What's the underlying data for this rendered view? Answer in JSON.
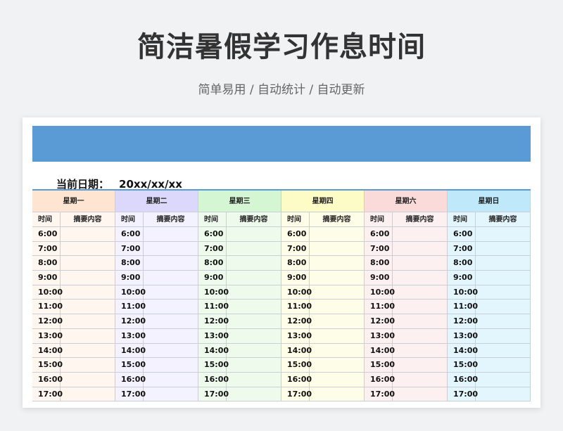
{
  "header": {
    "title": "简洁暑假学习作息时间",
    "subtitle": "简单易用 / 自动统计 / 自动更新"
  },
  "sheet": {
    "date_label": "当前日期：",
    "date_value": "20xx/xx/xx",
    "time_header": "时间",
    "note_header": "摘要内容",
    "days": [
      {
        "label": "星期一",
        "head_color": "#fde5d2",
        "body_color": "#fef6ef"
      },
      {
        "label": "星期二",
        "head_color": "#dcd8fb",
        "body_color": "#f3f2fe"
      },
      {
        "label": "星期三",
        "head_color": "#d4f6d2",
        "body_color": "#eefbec"
      },
      {
        "label": "星期四",
        "head_color": "#fdfbc6",
        "body_color": "#fefde8"
      },
      {
        "label": "星期六",
        "head_color": "#fbdada",
        "body_color": "#fdf0f0"
      },
      {
        "label": "星期日",
        "head_color": "#bfe9fb",
        "body_color": "#e4f6fd"
      }
    ],
    "times": [
      "6:00",
      "7:00",
      "8:00",
      "9:00",
      "10:00",
      "11:00",
      "12:00",
      "13:00",
      "14:00",
      "15:00",
      "16:00",
      "17:00"
    ]
  }
}
